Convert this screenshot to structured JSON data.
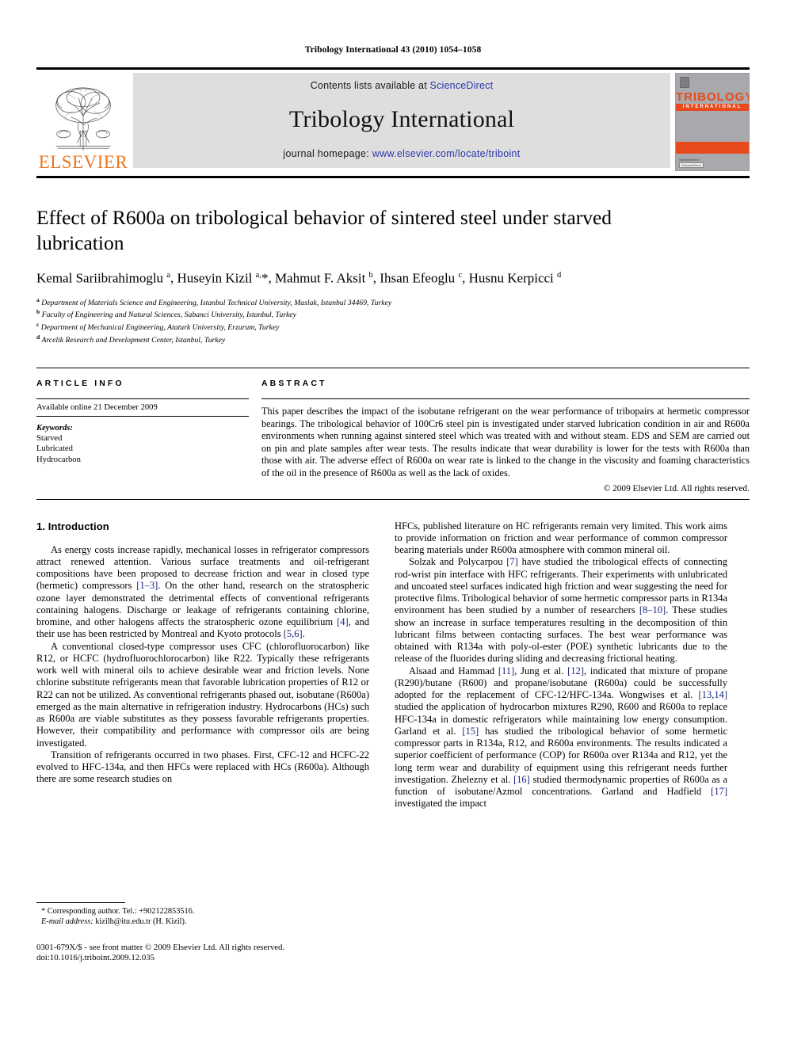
{
  "running_head": "Tribology International 43 (2010) 1054–1058",
  "masthead": {
    "elsevier_wordmark": "ELSEVIER",
    "contents_prefix": "Contents lists available at ",
    "contents_link": "ScienceDirect",
    "journal_name": "Tribology International",
    "homepage_prefix": "journal homepage: ",
    "homepage_url": "www.elsevier.com/locate/triboint",
    "cover": {
      "title": "TRIBOLOGY",
      "subtitle": "INTERNATIONAL",
      "footer_line1": "ScienceDirect",
      "footer_badge": "ScienceDirect"
    }
  },
  "article": {
    "title": "Effect of R600a on tribological behavior of sintered steel under starved lubrication",
    "authors_html": "Kemal Sariibrahimoglu <sup>a</sup>, Huseyin Kizil <sup>a,</sup>*, Mahmut F. Aksit <sup>b</sup>, Ihsan Efeoglu <sup>c</sup>, Husnu Kerpicci <sup>d</sup>",
    "affiliations": [
      {
        "marker": "a",
        "text": "Department of Materials Science and Engineering, Istanbul Technical University, Maslak, Istanbul 34469, Turkey"
      },
      {
        "marker": "b",
        "text": "Faculty of Engineering and Natural Sciences, Sabanci University, Istanbul, Turkey"
      },
      {
        "marker": "c",
        "text": "Department of Mechanical Engineering, Ataturk University, Erzurum, Turkey"
      },
      {
        "marker": "d",
        "text": "Arcelik Research and Development Center, Istanbul, Turkey"
      }
    ]
  },
  "info": {
    "article_info_heading": "ARTICLE INFO",
    "abstract_heading": "ABSTRACT",
    "history": "Available online 21 December 2009",
    "keywords_label": "Keywords:",
    "keywords": [
      "Starved",
      "Lubricated",
      "Hydrocarbon"
    ],
    "abstract": "This paper describes the impact of the isobutane refrigerant on the wear performance of tribopairs at hermetic compressor bearings. The tribological behavior of 100Cr6 steel pin is investigated under starved lubrication condition in air and R600a environments when running against sintered steel which was treated with and without steam. EDS and SEM are carried out on pin and plate samples after wear tests. The results indicate that wear durability is lower for the tests with R600a than those with air. The adverse effect of R600a on wear rate is linked to the change in the viscosity and foaming characteristics of the oil in the presence of R600a as well as the lack of oxides.",
    "copyright": "© 2009 Elsevier Ltd. All rights reserved."
  },
  "body": {
    "section_title": "1. Introduction",
    "left_paragraphs": [
      "As energy costs increase rapidly, mechanical losses in refrigerator compressors attract renewed attention. Various surface treatments and oil-refrigerant compositions have been proposed to decrease friction and wear in closed type (hermetic) compressors <span class=\"ref\">[1–3]</span>. On the other hand, research on the stratospheric ozone layer demonstrated the detrimental effects of conventional refrigerants containing halogens. Discharge or leakage of refrigerants containing chlorine, bromine, and other halogens affects the stratospheric ozone equilibrium <span class=\"ref\">[4]</span>, and their use has been restricted by Montreal and Kyoto protocols <span class=\"ref\">[5,6]</span>.",
      "A conventional closed-type compressor uses CFC (chlorofluorocarbon) like R12, or HCFC (hydrofluorochlorocarbon) like R22. Typically these refrigerants work well with mineral oils to achieve desirable wear and friction levels. None chlorine substitute refrigerants mean that favorable lubrication properties of R12 or R22 can not be utilized. As conventional refrigerants phased out, isobutane (R600a) emerged as the main alternative in refrigeration industry. Hydrocarbons (HCs) such as R600a are viable substitutes as they possess favorable refrigerants properties. However, their compatibility and performance with compressor oils are being investigated.",
      "Transition of refrigerants occurred in two phases. First, CFC-12 and HCFC-22 evolved to HFC-134a, and then HFCs were replaced with HCs (R600a). Although there are some research studies on"
    ],
    "right_paragraphs": [
      "HFCs, published literature on HC refrigerants remain very limited. This work aims to provide information on friction and wear performance of common compressor bearing materials under R600a atmosphere with common mineral oil.",
      "Solzak and Polycarpou <span class=\"ref\">[7]</span> have studied the tribological effects of connecting rod-wrist pin interface with HFC refrigerants. Their experiments with unlubricated and uncoated steel surfaces indicated high friction and wear suggesting the need for protective films. Tribological behavior of some hermetic compressor parts in R134a environment has been studied by a number of researchers <span class=\"ref\">[8–10]</span>. These studies show an increase in surface temperatures resulting in the decomposition of thin lubricant films between contacting surfaces. The best wear performance was obtained with R134a with poly-ol-ester (POE) synthetic lubricants due to the release of the fluorides during sliding and decreasing frictional heating.",
      "Alsaad and Hammad <span class=\"ref\">[11]</span>, Jung et al. <span class=\"ref\">[12]</span>, indicated that mixture of propane (R290)/butane (R600) and propane/isobutane (R600a) could be successfully adopted for the replacement of CFC-12/HFC-134a. Wongwises et al. <span class=\"ref\">[13,14]</span> studied the application of hydrocarbon mixtures R290, R600 and R600a to replace HFC-134a in domestic refrigerators while maintaining low energy consumption. Garland et al. <span class=\"ref\">[15]</span> has studied the tribological behavior of some hermetic compressor parts in R134a, R12, and R600a environments. The results indicated a superior coefficient of performance (COP) for R600a over R134a and R12, yet the long term wear and durability of equipment using this refrigerant needs further investigation. Zhelezny et al. <span class=\"ref\">[16]</span> studied thermodynamic properties of R600a as a function of isobutane/Azmol concentrations. Garland and Hadfield <span class=\"ref\">[17]</span> investigated the impact"
    ]
  },
  "footnotes": {
    "corresponding": "* Corresponding author. Tel.: +902122853516.",
    "email_label": "E-mail address:",
    "email_value": " kizilh@itu.edu.tr (H. Kizil).",
    "issn_line": "0301-679X/$ - see front matter © 2009 Elsevier Ltd. All rights reserved.",
    "doi_line": "doi:10.1016/j.triboint.2009.12.035"
  },
  "colors": {
    "link_blue": "#2a35a8",
    "reference_blue": "#16257e",
    "elsevier_orange": "#E87722",
    "cover_orange": "#E8491D",
    "band_gray": "#dededf"
  }
}
